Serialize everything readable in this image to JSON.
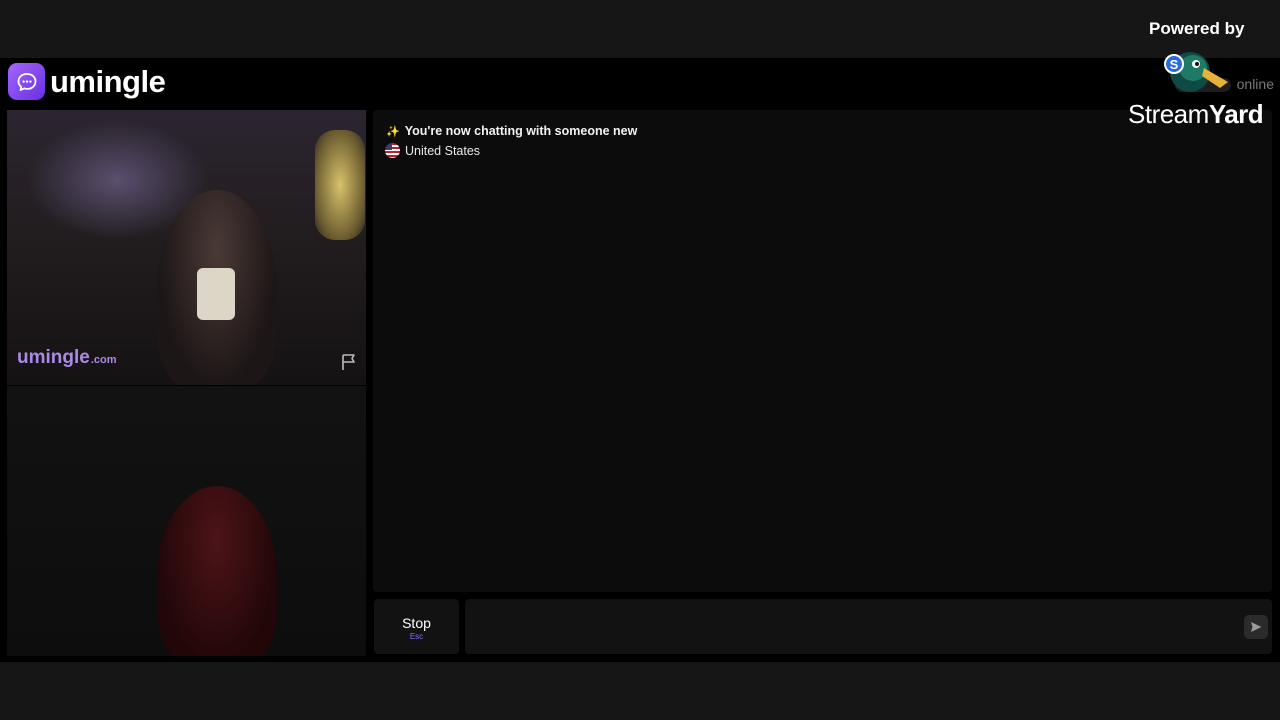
{
  "brand": {
    "name": "umingle",
    "watermark": "umingle",
    "watermark_tld": ".com"
  },
  "header": {
    "online_label": "online"
  },
  "chat": {
    "status_message": "You're now chatting with someone new",
    "country": "United States"
  },
  "controls": {
    "stop_label": "Stop",
    "stop_shortcut": "Esc",
    "message_placeholder": ""
  },
  "overlay": {
    "powered_by": "Powered by",
    "stream_brand_light": "Stream",
    "stream_brand_bold": "Yard"
  },
  "colors": {
    "accent": "#8a5cf6",
    "background": "#000000",
    "panel": "#0c0c0c"
  },
  "icons": [
    "chat-bubble-icon",
    "flag-icon",
    "sparkle-icon",
    "us-flag-icon",
    "send-icon",
    "streamyard-duck-icon"
  ]
}
